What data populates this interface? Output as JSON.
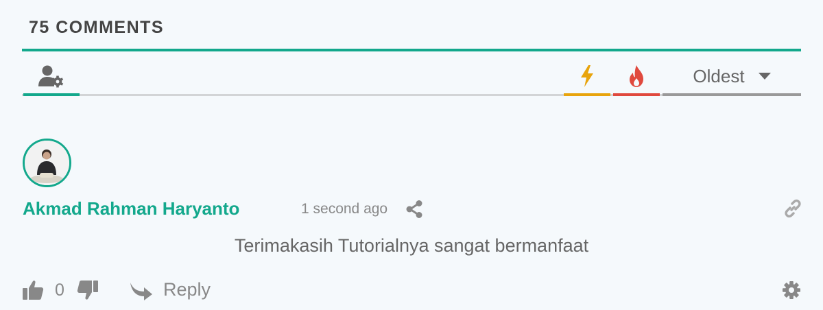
{
  "header": {
    "comment_count_label": "75 COMMENTS"
  },
  "filters": {
    "subscribe_icon": "user-gear-icon",
    "trending_icon": "lightning-bolt-icon",
    "hot_icon": "fire-icon",
    "sort_selected": "Oldest",
    "sort_icon": "caret-down-icon"
  },
  "comment": {
    "author": "Akmad Rahman Haryanto",
    "timestamp": "1 second ago",
    "text": "Terimakasih Tutorialnya sangat bermanfaat",
    "votes": "0",
    "reply_label": "Reply"
  },
  "colors": {
    "accent": "#13a88c",
    "trending": "#e8a40d",
    "hot": "#e0493e",
    "background": "#f5f9fc"
  }
}
